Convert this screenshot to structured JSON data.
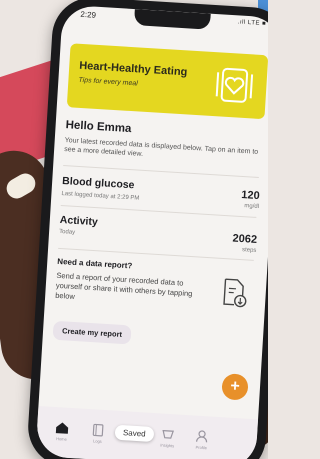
{
  "status": {
    "time": "2:29",
    "signal": ".ıll LTE ■"
  },
  "hero": {
    "title": "Heart-Healthy Eating",
    "subtitle": "Tips for every meal"
  },
  "greeting": {
    "title": "Hello Emma",
    "description": "Your latest recorded data is displayed below. Tap on an item to see a more detailed view."
  },
  "metrics": [
    {
      "label": "Blood glucose",
      "sub": "Last logged today at 2:29 PM",
      "value": "120",
      "unit": "mg/dl"
    },
    {
      "label": "Activity",
      "sub": "Today",
      "value": "2062",
      "unit": "steps"
    }
  ],
  "report": {
    "title": "Need a data report?",
    "description": "Send a report of your recorded data to yourself or share it with others by tapping below",
    "button": "Create my report"
  },
  "fab": {
    "label": "+"
  },
  "toast": {
    "text": "Saved"
  },
  "tabs": [
    {
      "label": "Home",
      "icon": "home-icon"
    },
    {
      "label": "Logs",
      "icon": "logs-icon"
    },
    {
      "label": "",
      "icon": "saved-icon"
    },
    {
      "label": "Insights",
      "icon": "insights-icon"
    },
    {
      "label": "Profile",
      "icon": "profile-icon"
    }
  ],
  "colors": {
    "hero": "#e4d720",
    "fab": "#e8902a",
    "tab_active": "#1e1e22",
    "tab_inactive": "#9a96a0"
  }
}
